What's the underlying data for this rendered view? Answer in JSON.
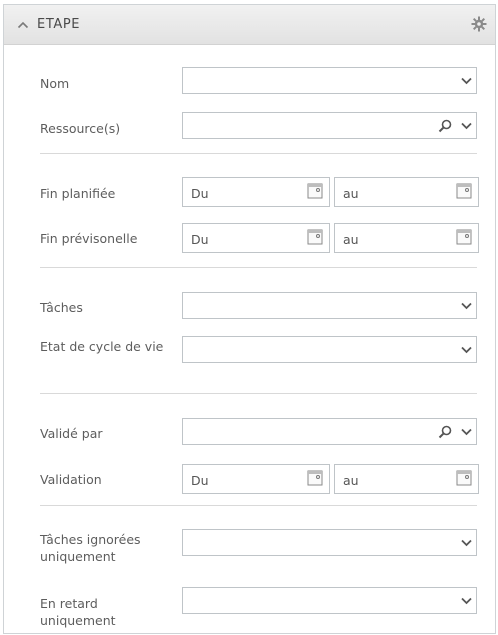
{
  "header": {
    "title": "ETAPE"
  },
  "fields": {
    "nom": {
      "label": "Nom",
      "value": ""
    },
    "ressources": {
      "label": "Ressource(s)",
      "value": ""
    },
    "fin_planifiee": {
      "label": "Fin planifiée",
      "from": "Du",
      "to": "au"
    },
    "fin_previsionelle": {
      "label": "Fin prévisonelle",
      "from": "Du",
      "to": "au"
    },
    "taches": {
      "label": "Tâches",
      "value": ""
    },
    "etat_cycle": {
      "label": "Etat de cycle de vie",
      "value": ""
    },
    "valide_par": {
      "label": "Validé par",
      "value": ""
    },
    "validation": {
      "label": "Validation",
      "from": "Du",
      "to": "au"
    },
    "taches_ignorees": {
      "label": "Tâches ignorées uniquement",
      "value": ""
    },
    "en_retard": {
      "label": "En retard uniquement",
      "value": ""
    }
  },
  "icons": {
    "collapse": "chevron-up-icon",
    "settings": "gear-icon",
    "dropdown": "chevron-down-icon",
    "search": "search-icon",
    "calendar": "calendar-icon"
  },
  "colors": {
    "border": "#bfc4c8",
    "header_bg": "#e8e8e8",
    "text": "#5d5d5d"
  }
}
